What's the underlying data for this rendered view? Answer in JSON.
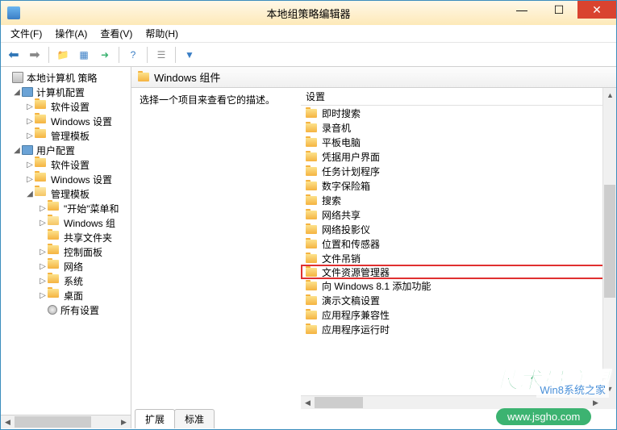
{
  "window": {
    "title": "本地组策略编辑器"
  },
  "menu": {
    "file": "文件(F)",
    "action": "操作(A)",
    "view": "查看(V)",
    "help": "帮助(H)"
  },
  "tree": {
    "root": "本地计算机 策略",
    "computer_config": "计算机配置",
    "software_settings": "软件设置",
    "windows_settings": "Windows 设置",
    "admin_templates": "管理模板",
    "user_config": "用户配置",
    "start_menu": "\"开始\"菜单和",
    "windows_components": "Windows 组",
    "shared_folders": "共享文件夹",
    "control_panel": "控制面板",
    "network": "网络",
    "system": "系统",
    "desktop": "桌面",
    "all_settings": "所有设置"
  },
  "detail": {
    "header_title": "Windows 组件",
    "description": "选择一个项目来查看它的描述。",
    "column_header": "设置"
  },
  "settings": [
    "即时搜索",
    "录音机",
    "平板电脑",
    "凭据用户界面",
    "任务计划程序",
    "数字保险箱",
    "搜索",
    "网络共享",
    "网络投影仪",
    "位置和传感器",
    "文件吊销",
    "文件资源管理器",
    "向 Windows 8.1 添加功能",
    "演示文稿设置",
    "应用程序兼容性",
    "应用程序运行时"
  ],
  "highlighted_index": 11,
  "tabs": {
    "extended": "扩展",
    "standard": "标准"
  },
  "watermark": {
    "main": "技术员联盟",
    "sub": "Win8系统之家",
    "url": "www.jsgho.com"
  }
}
